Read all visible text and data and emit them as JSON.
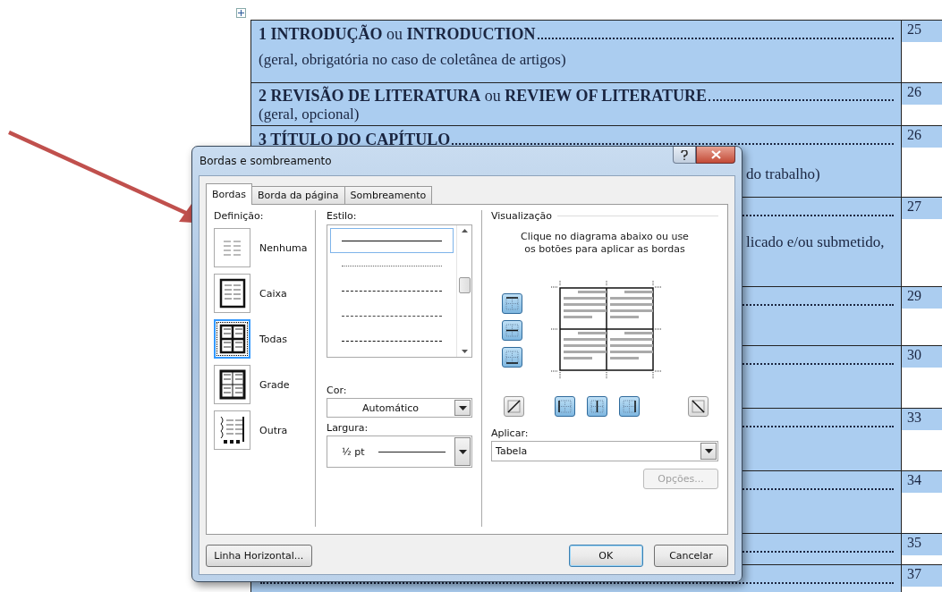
{
  "document": {
    "rows": [
      {
        "title": "**1 INTRODUÇÃO** ou **INTRODUCTION**",
        "note": "(geral, obrigatória no caso de coletânea de artigos)",
        "page": "25"
      },
      {
        "title": "**2 REVISÃO DE LITERATURA** ou **REVIEW OF LITERATURE**",
        "note": "(geral, opcional)",
        "page": "26"
      },
      {
        "title": "**3 TÍTULO DO CAPÍTULO**",
        "note": "do trabalho)",
        "page": "26"
      },
      {
        "note": "licado e/ou submetido,",
        "page": "27"
      },
      {
        "page": "29"
      },
      {
        "page": "30"
      },
      {
        "page": "33"
      },
      {
        "page": "34"
      },
      {
        "page": "35"
      },
      {
        "page": "37"
      }
    ]
  },
  "dialog": {
    "title": "Bordas e sombreamento",
    "tabs": [
      {
        "label": "Bordas",
        "selected": true
      },
      {
        "label": "Borda da página",
        "selected": false
      },
      {
        "label": "Sombreamento",
        "selected": false
      }
    ],
    "definition": {
      "label": "Definição:",
      "presets": [
        {
          "label": "Nenhuma",
          "kind": "none",
          "selected": false
        },
        {
          "label": "Caixa",
          "kind": "box",
          "selected": false
        },
        {
          "label": "Todas",
          "kind": "all",
          "selected": true
        },
        {
          "label": "Grade",
          "kind": "grid",
          "selected": false
        },
        {
          "label": "Outra",
          "kind": "custom",
          "selected": false
        }
      ]
    },
    "style": {
      "label": "Estilo:",
      "lines": [
        {
          "kind": "solid",
          "selected": true
        },
        {
          "kind": "dotted",
          "selected": false
        },
        {
          "kind": "dashed",
          "selected": false
        },
        {
          "kind": "longdash",
          "selected": false
        },
        {
          "kind": "dashdot",
          "selected": false
        }
      ]
    },
    "color": {
      "label": "Cor:",
      "value": "Automático"
    },
    "width": {
      "label": "Largura:",
      "value": "½ pt"
    },
    "preview": {
      "label": "Visualização",
      "hint": "Clique no diagrama abaixo ou use os botões para aplicar as bordas",
      "side_buttons": [
        {
          "kind": "top",
          "pressed": true
        },
        {
          "kind": "middle",
          "pressed": true
        },
        {
          "kind": "bottom",
          "pressed": true
        }
      ],
      "bottom_buttons": [
        {
          "kind": "diag-up",
          "pressed": false
        },
        {
          "kind": "left",
          "pressed": true
        },
        {
          "kind": "center",
          "pressed": true
        },
        {
          "kind": "right",
          "pressed": true
        },
        {
          "kind": "diag-down",
          "pressed": false
        }
      ]
    },
    "apply": {
      "label": "Aplicar:",
      "value": "Tabela"
    },
    "options": {
      "label": "Opções...",
      "disabled": true
    },
    "footer": {
      "horizontal": "Linha Horizontal...",
      "ok": "OK",
      "cancel": "Cancelar"
    }
  }
}
